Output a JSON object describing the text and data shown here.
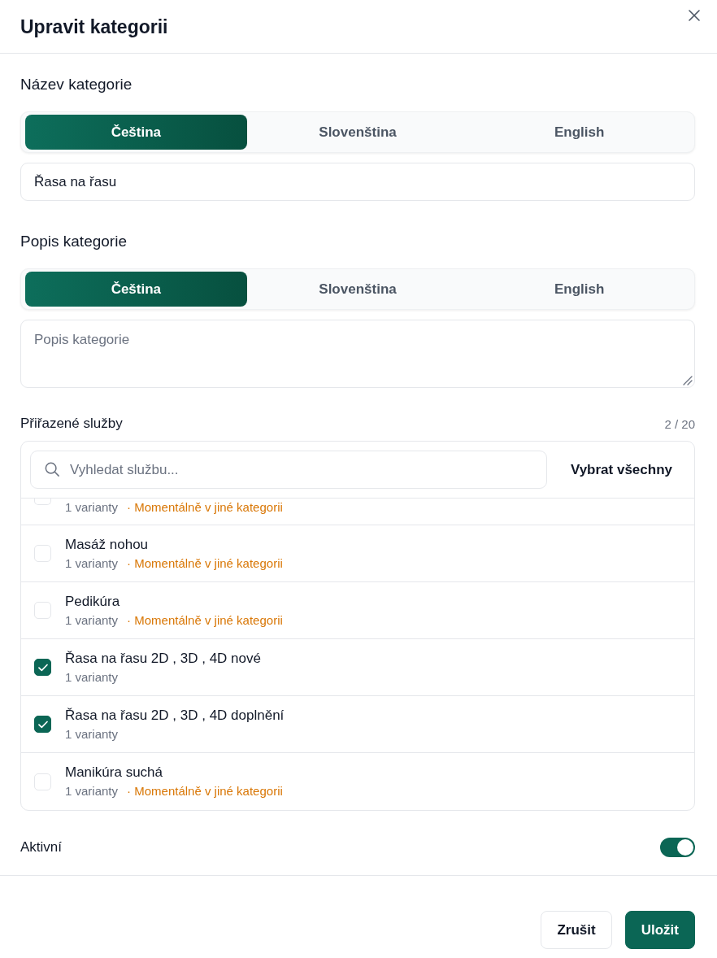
{
  "dialog": {
    "title": "Upravit kategorii"
  },
  "name_section": {
    "label": "Název kategorie",
    "tabs": [
      {
        "label": "Čeština",
        "selected": true
      },
      {
        "label": "Slovenština",
        "selected": false
      },
      {
        "label": "English",
        "selected": false
      }
    ],
    "value": "Řasa na řasu"
  },
  "description_section": {
    "label": "Popis kategorie",
    "tabs": [
      {
        "label": "Čeština",
        "selected": true
      },
      {
        "label": "Slovenština",
        "selected": false
      },
      {
        "label": "English",
        "selected": false
      }
    ],
    "placeholder": "Popis kategorie"
  },
  "services": {
    "label": "Přiřazené služby",
    "count": "2 / 20",
    "search": {
      "placeholder": "Vyhledat službu..."
    },
    "select_all": "Vybrat všechny",
    "items": [
      {
        "variants": "1 varianty",
        "note": "· Momentálně v jiné kategorii",
        "checked": false
      },
      {
        "name": "Masáž nohou",
        "variants": "1 varianty",
        "note": "· Momentálně v jiné kategorii",
        "checked": false
      },
      {
        "name": "Pedikúra",
        "variants": "1 varianty",
        "note": "· Momentálně v jiné kategorii",
        "checked": false
      },
      {
        "name": "Řasa na řasu 2D , 3D , 4D nové",
        "variants": "1 varianty",
        "checked": true
      },
      {
        "name": "Řasa na řasu 2D , 3D , 4D doplnění",
        "variants": "1 varianty",
        "checked": true
      },
      {
        "name": "Manikúra suchá",
        "variants": "1 varianty",
        "note": "· Momentálně v jiné kategorii",
        "checked": false
      }
    ]
  },
  "active": {
    "label": "Aktivní",
    "on": true
  },
  "buttons": [
    {
      "label": "Zrušit",
      "kind": "secondary"
    },
    {
      "label": "Uložit",
      "kind": "primary"
    }
  ]
}
